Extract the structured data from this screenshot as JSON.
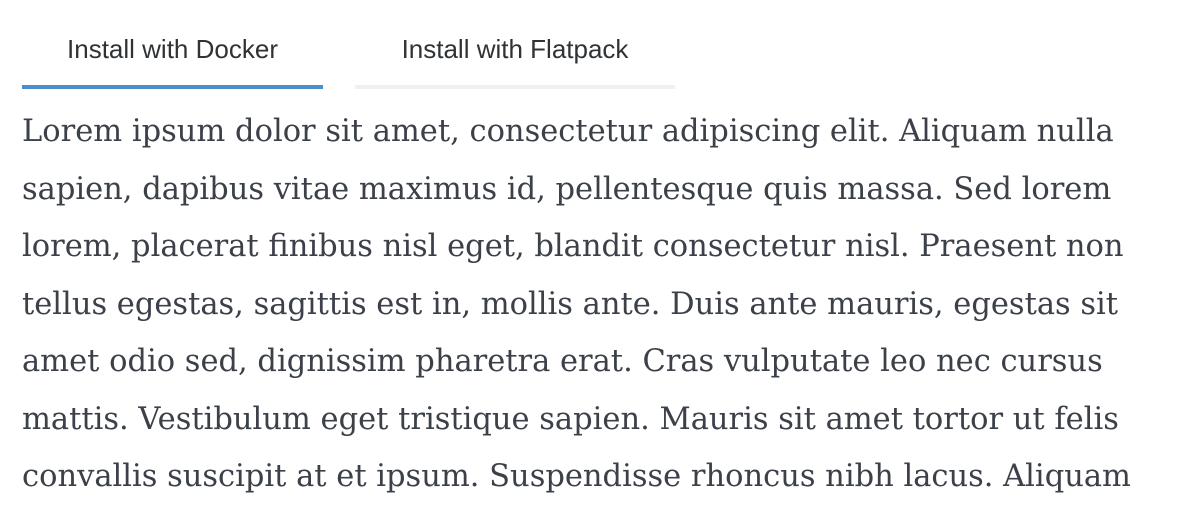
{
  "tabs": [
    {
      "label": "Install with Docker",
      "active": true
    },
    {
      "label": "Install with Flatpack",
      "active": false
    }
  ],
  "content": {
    "lines": [
      "Lorem ipsum dolor sit amet, consectetur adipiscing elit. Aliquam nulla",
      "sapien, dapibus vitae maximus id, pellentesque quis massa. Sed lorem",
      "lorem, placerat finibus nisl eget, blandit consectetur nisl. Praesent non",
      "tellus egestas, sagittis est in, mollis ante. Duis ante mauris, egestas sit",
      "amet odio sed, dignissim pharetra erat. Cras vulputate leo nec cursus",
      "mattis. Vestibulum eget tristique sapien. Mauris sit amet tortor ut felis",
      "convallis suscipit at et ipsum. Suspendisse rhoncus nibh lacus. Aliquam"
    ]
  },
  "colors": {
    "active_tab_indicator": "#4a8ecb",
    "inactive_tab_indicator": "#f0f0f0",
    "body_text": "#3b4049",
    "tab_text": "#2f3336"
  }
}
